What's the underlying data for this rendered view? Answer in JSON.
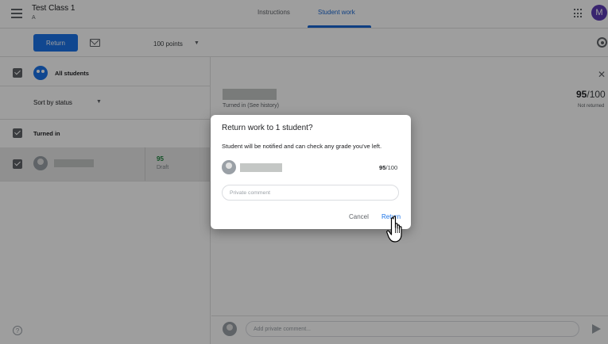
{
  "header": {
    "class_title": "Test Class 1",
    "class_subtitle": "A",
    "tabs": [
      {
        "label": "Instructions",
        "active": false
      },
      {
        "label": "Student work",
        "active": true
      }
    ],
    "avatar_letter": "M"
  },
  "toolbar": {
    "return_label": "Return",
    "points_label": "100 points"
  },
  "sidebar": {
    "all_students_label": "All students",
    "sort_label": "Sort by status",
    "section_label": "Turned in",
    "student_grade": "95",
    "student_grade_status": "Draft"
  },
  "detail": {
    "status_text": "Turned in (See history)",
    "score": "95",
    "score_max": "/100",
    "return_status": "Not returned",
    "comment_placeholder": "Add private comment..."
  },
  "dialog": {
    "title": "Return work to 1 student?",
    "body": "Student will be notified and can check any grade you've left.",
    "score": "95",
    "score_max": "/100",
    "comment_placeholder": "Private comment",
    "cancel_label": "Cancel",
    "return_label": "Return"
  },
  "colors": {
    "accent": "#1a73e8",
    "active_tab": "#1967d2",
    "grade_green": "#188038",
    "avatar": "#5c3bb3"
  }
}
